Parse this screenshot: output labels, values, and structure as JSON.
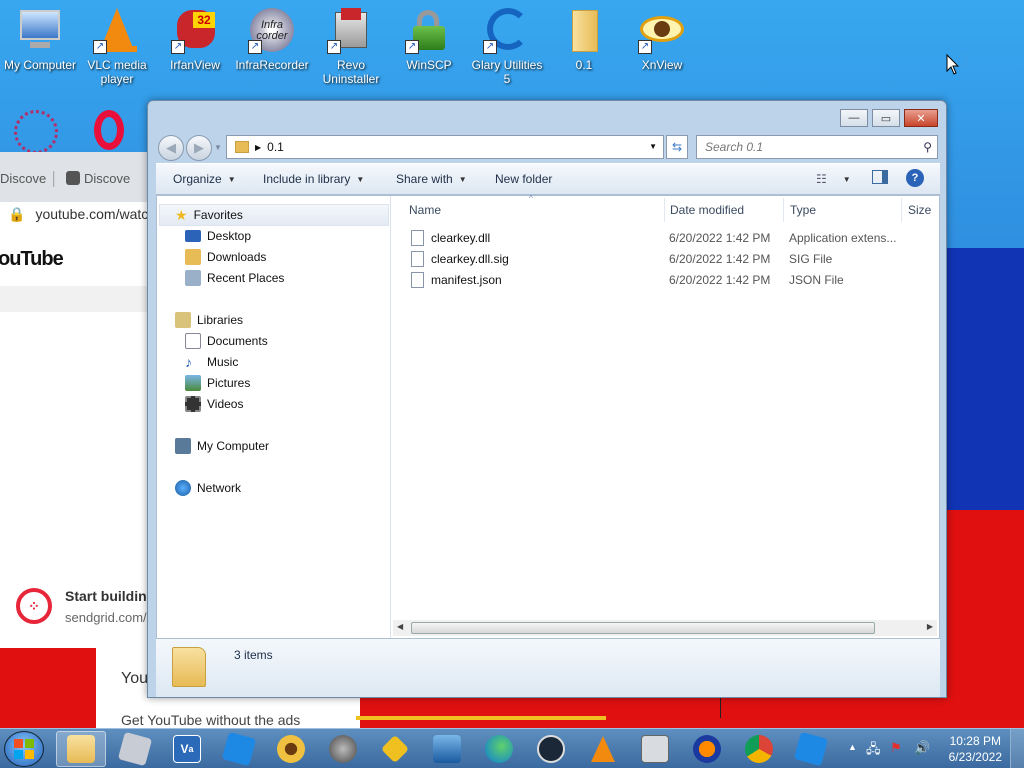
{
  "colors": {
    "wallpaper_blue": "#38a7f0",
    "wallpaper_navy": "#1034b4",
    "wallpaper_red": "#e01010",
    "taskbar": "#4a7aaf"
  },
  "desktop_icons": [
    {
      "label": "My Computer",
      "icon": "computer-icon"
    },
    {
      "label": "VLC media player",
      "icon": "vlc-cone-icon"
    },
    {
      "label": "IrfanView",
      "icon": "irfanview-icon",
      "badge": "32"
    },
    {
      "label": "InfraRecorder",
      "icon": "infrarecorder-disc-icon",
      "img_text": "Infra corder"
    },
    {
      "label": "Revo Uninstaller",
      "icon": "revo-uninstaller-icon"
    },
    {
      "label": "WinSCP",
      "icon": "winscp-lock-icon"
    },
    {
      "label": "Glary Utilities 5",
      "icon": "glary-utilities-icon"
    },
    {
      "label": "0.1",
      "icon": "folder-icon"
    },
    {
      "label": "XnView",
      "icon": "xnview-eye-icon"
    }
  ],
  "browser": {
    "tabs": [
      "Discove",
      "Discove"
    ],
    "url": "youtube.com/watc",
    "logo": "ouTube",
    "ad_title": "Start building",
    "ad_url": "sendgrid.com/",
    "premium_title": "You",
    "premium_text": "Get YouTube without the ads"
  },
  "explorer": {
    "caption_buttons": {
      "minimize": "—",
      "maximize": "▭",
      "close": "✕"
    },
    "breadcrumb": "0.1",
    "search_placeholder": "Search 0.1",
    "toolbar": {
      "organize": "Organize",
      "include_in_library": "Include in library",
      "share_with": "Share with",
      "new_folder": "New folder"
    },
    "nav": {
      "favorites": "Favorites",
      "favorites_items": [
        "Desktop",
        "Downloads",
        "Recent Places"
      ],
      "libraries": "Libraries",
      "libraries_items": [
        "Documents",
        "Music",
        "Pictures",
        "Videos"
      ],
      "computer": "My Computer",
      "network": "Network"
    },
    "columns": {
      "name": "Name",
      "date": "Date modified",
      "type": "Type",
      "size": "Size"
    },
    "files": [
      {
        "name": "clearkey.dll",
        "date": "6/20/2022 1:42 PM",
        "type": "Application extens..."
      },
      {
        "name": "clearkey.dll.sig",
        "date": "6/20/2022 1:42 PM",
        "type": "SIG File"
      },
      {
        "name": "manifest.json",
        "date": "6/20/2022 1:42 PM",
        "type": "JSON File"
      }
    ],
    "status": "3 items"
  },
  "taskbar": {
    "vs_label": "V",
    "vs_badge": "a",
    "clock_time": "10:28 PM",
    "clock_date": "6/23/2022"
  }
}
